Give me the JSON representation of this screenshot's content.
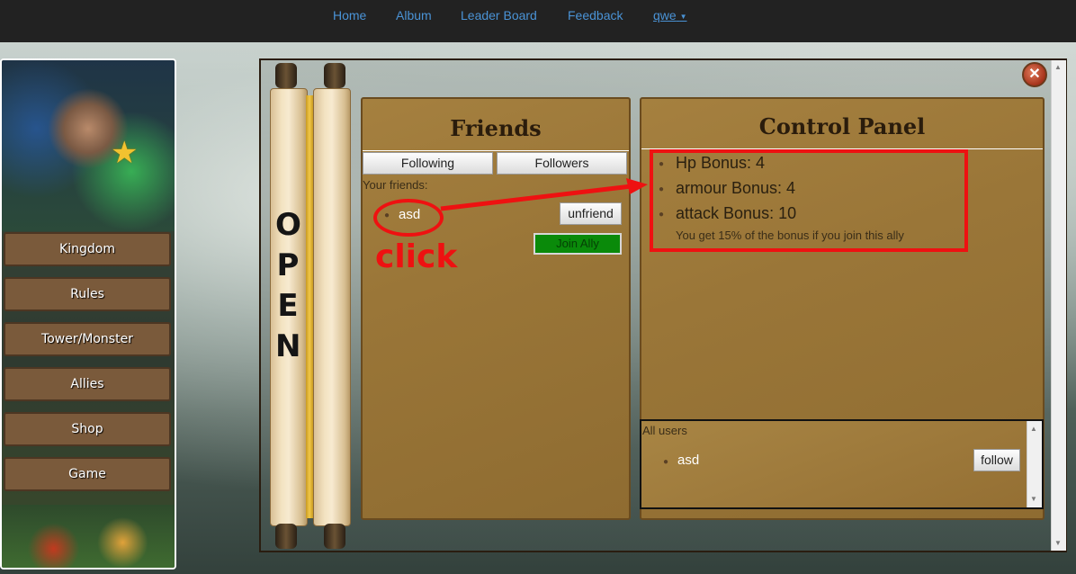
{
  "nav": {
    "items": [
      "Home",
      "Album",
      "Leader Board",
      "Feedback"
    ],
    "user": "qwe"
  },
  "sidebar": {
    "menu": [
      "Kingdom",
      "Rules",
      "Tower/Monster",
      "Allies",
      "Shop",
      "Game"
    ]
  },
  "scroll": {
    "letters": [
      "O",
      "P",
      "E",
      "N"
    ]
  },
  "friends": {
    "title": "Friends",
    "tab_following": "Following",
    "tab_followers": "Followers",
    "your_friends_label": "Your friends:",
    "friend_name": "asd",
    "unfriend_label": "unfriend",
    "join_label": "Join Ally"
  },
  "annotation": {
    "click_text": "click",
    "color": "#ee1111"
  },
  "control_panel": {
    "title": "Control Panel",
    "bonuses": [
      "Hp Bonus: 4",
      "armour Bonus: 4",
      "attack Bonus: 10"
    ],
    "note": "You get 15% of the bonus if you join this ally"
  },
  "all_users": {
    "label": "All users",
    "user_name": "asd",
    "follow_label": "follow"
  },
  "colors": {
    "nav_bg": "#222222",
    "link": "#4a93d6",
    "panel": "#9a7638",
    "join_green": "#0a8a0a"
  }
}
